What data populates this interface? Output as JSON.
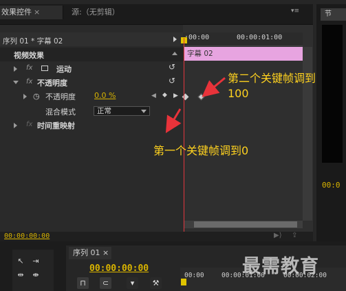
{
  "tabs": {
    "effect_controls": "效果控件",
    "close": "×",
    "source": "源:（无剪辑）",
    "panel_menu": "▾≡",
    "right_tab": "节"
  },
  "sequence_header": "序列 01 * 字幕 02",
  "ruler": {
    "start": ";00:00",
    "mark": "00:00:01:00"
  },
  "clip_label": "字幕 02",
  "effects": {
    "section": "视频效果",
    "motion": "运动",
    "opacity": "不透明度",
    "opacity_param": "不透明度",
    "opacity_value": "0.0 %",
    "blend_mode_label": "混合模式",
    "blend_mode_value": "正常",
    "time_remap": "时间重映射",
    "fx": "fx",
    "reset": "↺"
  },
  "annotations": {
    "second": "第二个关键帧调到",
    "second_value": "100",
    "first": "第一个关键帧调到0"
  },
  "bottom_time": "00:00:00:00",
  "right_panel_time": "00:0",
  "sequence_panel": {
    "tab": "序列 01 ×",
    "time": "00:00:00:00",
    "ticks": [
      "00:00",
      "00:00:01:00",
      "00:00:02:00"
    ]
  },
  "watermark": "最需教育",
  "colors": {
    "accent_yellow": "#d9b400",
    "annotation": "#ffd21f",
    "clip_pink": "#e7a4e0",
    "playhead_red": "#e0333b",
    "arrow_red": "#e8333a"
  }
}
